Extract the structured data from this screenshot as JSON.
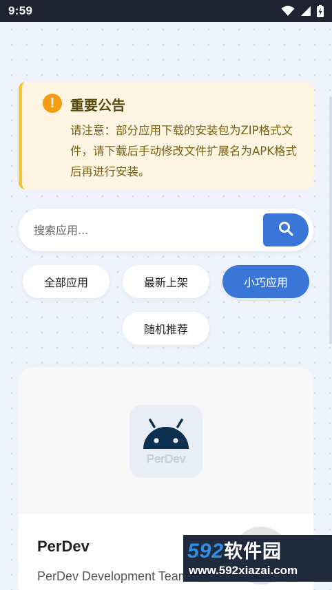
{
  "status_bar": {
    "time": "9:59",
    "icons": [
      "wifi-icon",
      "signal-icon",
      "battery-charging-icon"
    ]
  },
  "notice": {
    "icon": "exclamation-icon",
    "title": "重要公告",
    "body": "请注意：部分应用下载的安装包为ZIP格式文件，请下载后手动修改文件扩展名为APK格式后再进行安装。"
  },
  "search": {
    "placeholder": "搜索应用...",
    "value": "",
    "button_icon": "search-icon"
  },
  "filters": [
    {
      "label": "全部应用",
      "active": false
    },
    {
      "label": "最新上架",
      "active": false
    },
    {
      "label": "小巧应用",
      "active": true
    },
    {
      "label": "随机推荐",
      "active": false
    }
  ],
  "app_card": {
    "icon": "android-icon",
    "icon_text": "PerDev",
    "title": "PerDev",
    "developer": "PerDev Development Team"
  },
  "watermark": {
    "line1_num": "592",
    "line1_cn": "软件园",
    "line2": "www.592xiazai.com"
  },
  "colors": {
    "accent": "#3a76d8",
    "notice_bg": "#fdf5e1",
    "notice_border": "#f4c232",
    "notice_icon": "#f39c12",
    "status_bar": "#1f2331"
  }
}
